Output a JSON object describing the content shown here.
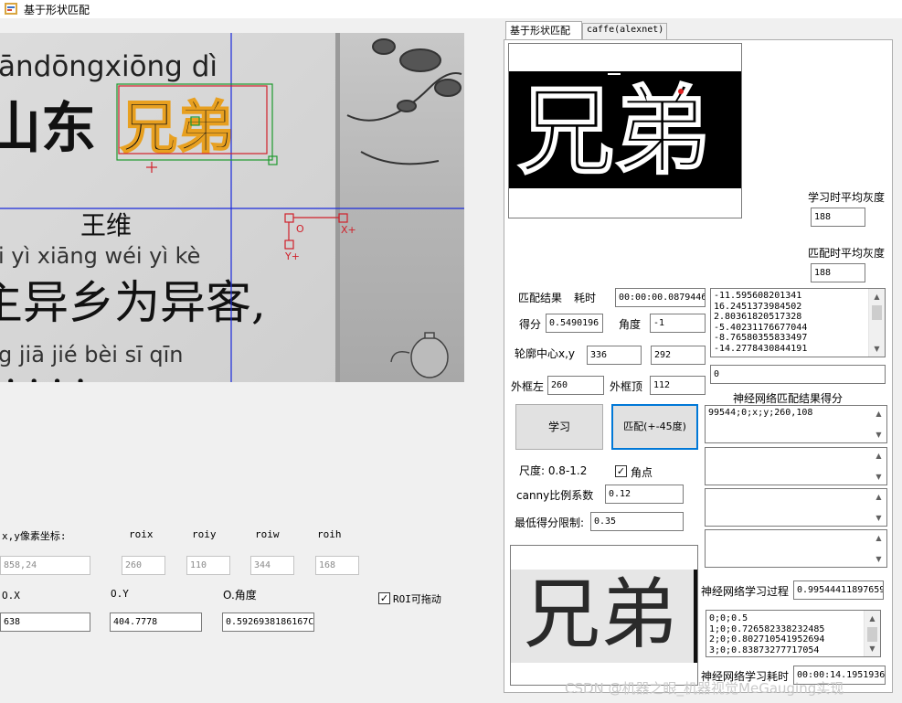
{
  "window": {
    "title": "基于形状匹配"
  },
  "image_view": {
    "pinyin_top": "āndōngxiōng  dì",
    "title_chars": "山东",
    "highlight_chars": "兄弟",
    "author": "王维",
    "pinyin_mid": "i   yì  xiāng wéi    yì    kè",
    "line2_chars": "主异乡为异客,",
    "pinyin_bottom": "g  jiā    jié   bèi    sī   qīn",
    "axis_origin": "O",
    "axis_x": "X+",
    "axis_y": "Y+"
  },
  "left_form": {
    "pixel_coord_label": "x,y像素坐标:",
    "pixel_coord_value": "858,24",
    "roix_label": "roix",
    "roix_value": "260",
    "roiy_label": "roiy",
    "roiy_value": "110",
    "roiw_label": "roiw",
    "roiw_value": "344",
    "roih_label": "roih",
    "roih_value": "168",
    "ox_label": "O.X",
    "ox_value": "638",
    "oy_label": "O.Y",
    "oy_value": "404.7778",
    "oangle_label": "O.角度",
    "oangle_value": "0.5926938186167C",
    "roi_drag_label": "ROI可拖动",
    "roi_drag_checked": true
  },
  "tabs": [
    {
      "label": "基于形状匹配",
      "active": true
    },
    {
      "label": "caffe(alexnet)",
      "active": false
    }
  ],
  "right_panel": {
    "template_chars": "兄弟",
    "learn_gray_label": "学习时平均灰度",
    "learn_gray_value": "188",
    "match_gray_label": "匹配时平均灰度",
    "match_gray_value": "188",
    "match_result_label": "匹配结果",
    "time_label": "耗时",
    "time_value": "00:00:00.0879446",
    "score_label": "得分",
    "score_value": "0.5490196",
    "angle_label": "角度",
    "angle_value": "-1",
    "center_label": "轮廓中心x,y",
    "center_x": "336",
    "center_y": "292",
    "box_left_label": "外框左",
    "box_left_value": "260",
    "box_top_label": "外框顶",
    "box_top_value": "112",
    "values_list": [
      "-11.595608201341",
      "16.2451373984502",
      "2.80361820517328",
      "-5.40231176677044",
      "-8.76580355833497",
      "-14.2778430844191"
    ],
    "single_value": "0",
    "nn_score_label": "神经网络匹配结果得分",
    "nn_score_value": "99544;0;x;y;260,108",
    "learn_button": "学习",
    "match_button": "匹配(+-45度)",
    "scale_label": "尺度: 0.8-1.2",
    "corner_label": "角点",
    "corner_checked": true,
    "canny_label": "canny比例系数",
    "canny_value": "0.12",
    "min_score_label": "最低得分限制:",
    "min_score_value": "0.35",
    "preview_chars": "兄弟",
    "nn_learn_label": "神经网络学习过程",
    "nn_learn_value": "0.99544411897659",
    "nn_learn_list": [
      "0;0;0.5",
      "1;0;0.726582338232485",
      "2;0;0.802710541952694",
      "3;0;0.83873277717054"
    ],
    "nn_time_label": "神经网络学习耗时",
    "nn_time_value": "00:00:14.1951936"
  },
  "watermark": "CSDN @机器之眼_机器视觉MeGauging实现"
}
